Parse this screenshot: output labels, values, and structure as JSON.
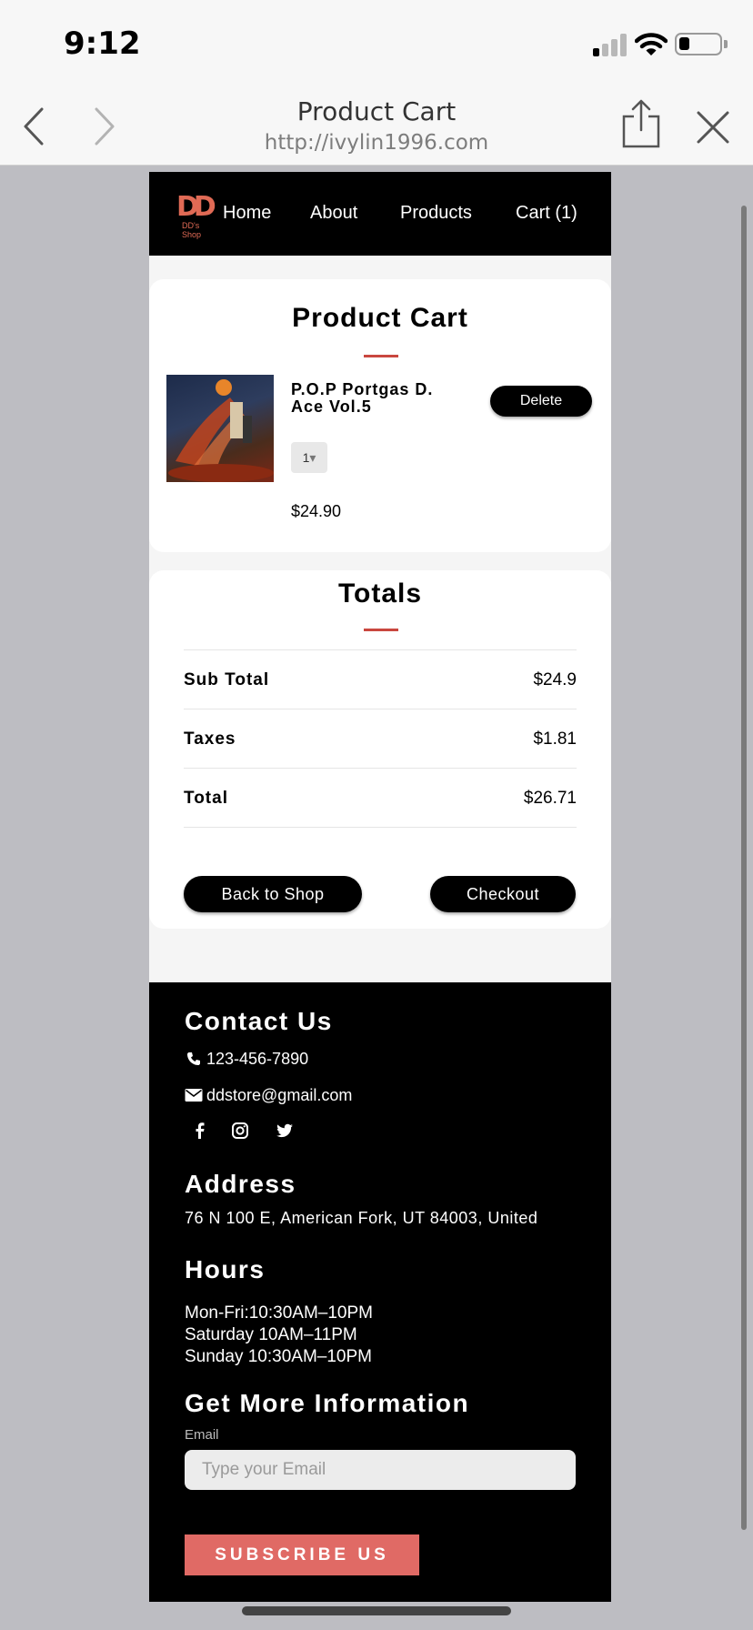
{
  "status_bar": {
    "time": "9:12"
  },
  "browser": {
    "title": "Product Cart",
    "url": "http://ivylin1996.com"
  },
  "site": {
    "logo_text": "DD's Shop",
    "logo_mark": "DD",
    "nav": [
      {
        "label": "Home"
      },
      {
        "label": "About"
      },
      {
        "label": "Products"
      },
      {
        "label": "Cart (1)"
      }
    ]
  },
  "cart": {
    "title": "Product Cart",
    "item": {
      "name": "P.O.P Portgas D. Ace Vol.5",
      "quantity": "1",
      "price": "$24.90",
      "delete_label": "Delete"
    }
  },
  "totals": {
    "title": "Totals",
    "rows": [
      {
        "label": "Sub Total",
        "value": "$24.9"
      },
      {
        "label": "Taxes",
        "value": "$1.81"
      },
      {
        "label": "Total",
        "value": "$26.71"
      }
    ],
    "back_label": "Back to Shop",
    "checkout_label": "Checkout"
  },
  "footer": {
    "contact_heading": "Contact Us",
    "phone": "123-456-7890",
    "email": "ddstore@gmail.com",
    "address_heading": "Address",
    "address": "76 N 100 E, American Fork, UT 84003, United",
    "hours_heading": "Hours",
    "hours": [
      "Mon-Fri:10:30AM–10PM",
      "Saturday 10AM–11PM",
      "Sunday 10:30AM–10PM"
    ],
    "info_heading": "Get More Information",
    "email_label": "Email",
    "email_placeholder": "Type your Email",
    "subscribe_label": "SUBSCRIBE US"
  },
  "colors": {
    "accent": "#e06a65",
    "accent_line": "#c9473f",
    "header_bg": "#000000",
    "page_bg": "#f5f5f5",
    "browser_bg": "#f7f7f7"
  },
  "icons": {
    "status": [
      "signal-icon",
      "wifi-icon",
      "battery-icon"
    ],
    "browser": [
      "back-arrow-icon",
      "forward-arrow-icon",
      "share-icon",
      "close-icon"
    ],
    "footer": [
      "phone-icon",
      "envelope-icon",
      "facebook-icon",
      "instagram-icon",
      "twitter-icon"
    ]
  }
}
